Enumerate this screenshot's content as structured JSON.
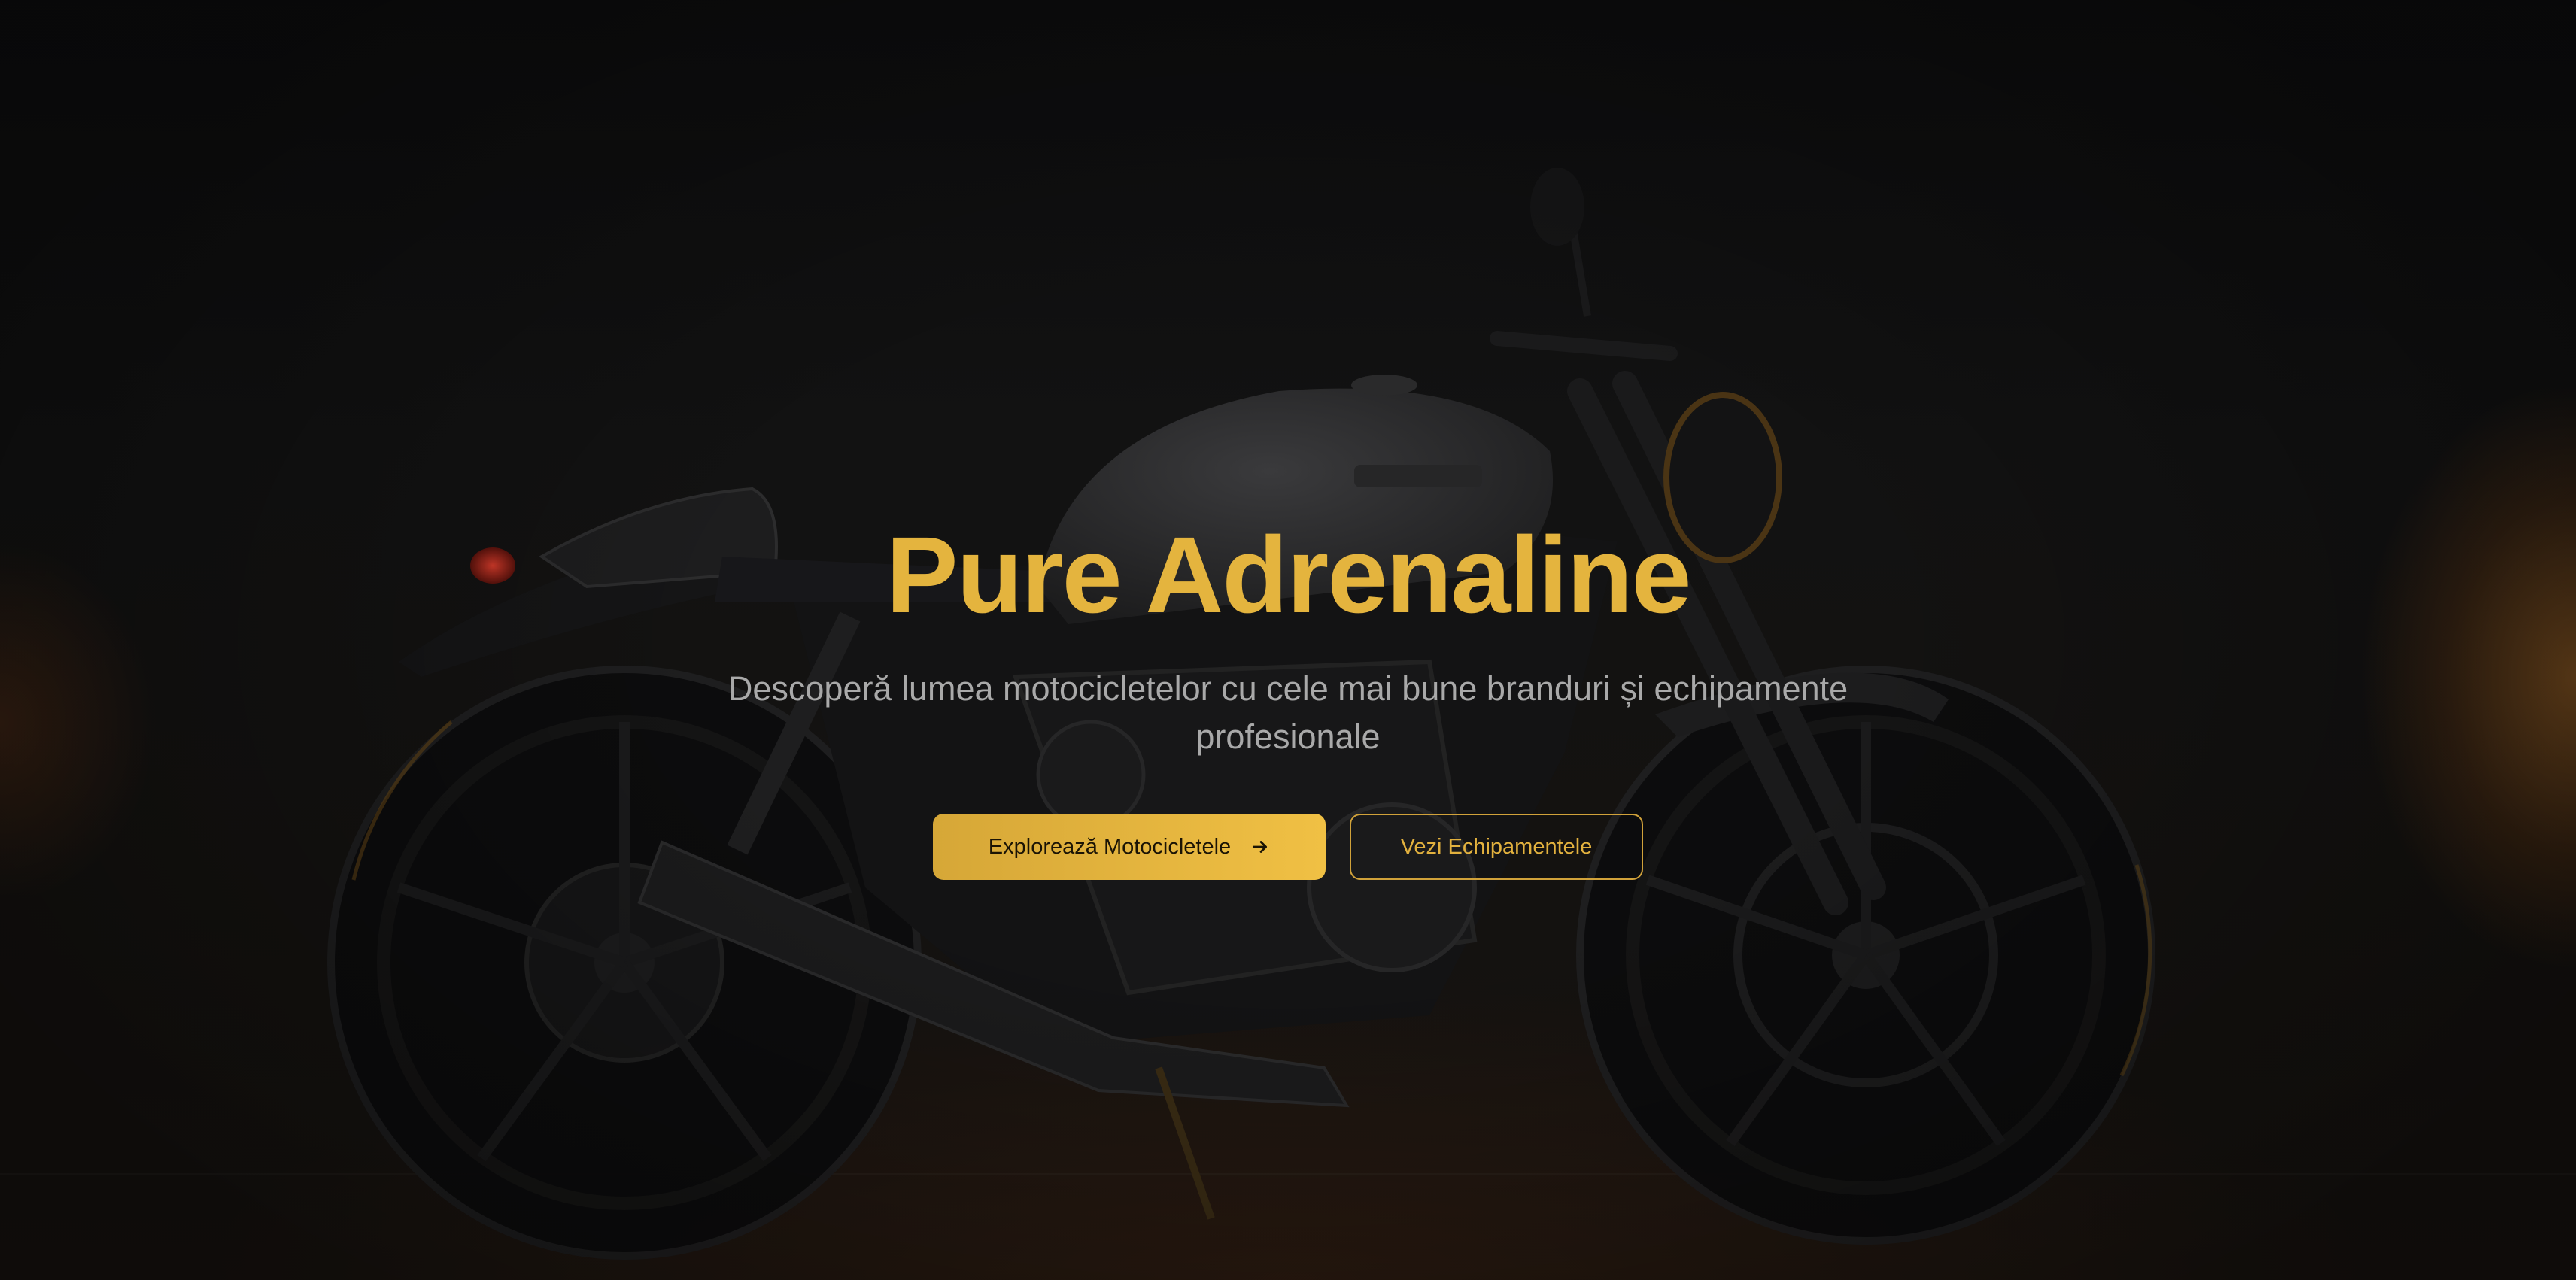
{
  "hero": {
    "title": "Pure Adrenaline",
    "subtitle": "Descoperă lumea motocicletelor cu cele mai bune branduri și echipamente profesionale",
    "primary_button": "Explorează Motocicletele",
    "primary_icon": "arrow-right-icon",
    "secondary_button": "Vezi Echipamentele"
  },
  "colors": {
    "accent": "#e4b43e",
    "button_fill": "#f0c044",
    "background": "#121212",
    "subtitle_text": "#a9a9a9"
  }
}
